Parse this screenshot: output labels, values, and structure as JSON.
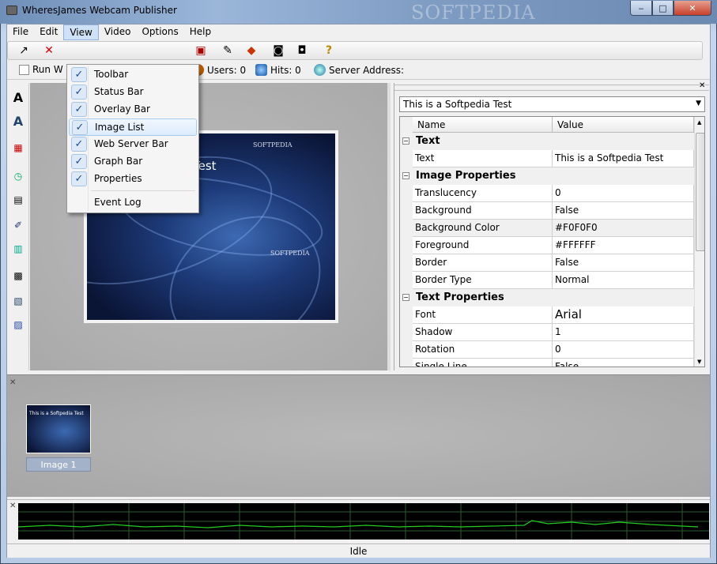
{
  "window": {
    "title": "WheresJames Webcam Publisher",
    "watermark": "SOFTPEDIA",
    "min": "‒",
    "max": "□",
    "close": "✕"
  },
  "menubar": [
    "File",
    "Edit",
    "View",
    "Video",
    "Options",
    "Help"
  ],
  "status_strip": {
    "run_label": "Run W",
    "users": "Users: 0",
    "hits": "Hits: 0",
    "server": "Server Address:"
  },
  "view_menu": {
    "items": [
      {
        "label": "Toolbar",
        "checked": true
      },
      {
        "label": "Status Bar",
        "checked": true
      },
      {
        "label": "Overlay Bar",
        "checked": true
      },
      {
        "label": "Image List",
        "checked": true
      },
      {
        "label": "Web Server Bar",
        "checked": true
      },
      {
        "label": "Graph Bar",
        "checked": true
      },
      {
        "label": "Properties",
        "checked": true
      }
    ],
    "event_log": "Event Log",
    "check_glyph": "✓"
  },
  "preview": {
    "overlay_text": "Test",
    "logo_top": "SOFTPEDIA",
    "logo_mid": "SOFTPEDIA"
  },
  "properties": {
    "combo_value": "This is a Softpedia Test",
    "col_name": "Name",
    "col_value": "Value",
    "categories": {
      "text": "Text",
      "image": "Image Properties",
      "textprops": "Text Properties"
    },
    "rows": {
      "text": [
        "Text",
        "This is a Softpedia Test"
      ],
      "translucency": [
        "Translucency",
        "0"
      ],
      "background": [
        "Background",
        "False"
      ],
      "background_color": [
        "Background Color",
        "#F0F0F0"
      ],
      "foreground": [
        "Foreground",
        "#FFFFFF"
      ],
      "border": [
        "Border",
        "False"
      ],
      "border_type": [
        "Border Type",
        "Normal"
      ],
      "font": [
        "Font",
        "Arial"
      ],
      "shadow": [
        "Shadow",
        "1"
      ],
      "rotation": [
        "Rotation",
        "0"
      ],
      "single_line": [
        "Single Line",
        "False"
      ]
    }
  },
  "image_list": {
    "thumb_label": "Image 1",
    "thumb_text": "This is a Softpedia Test"
  },
  "status": {
    "text": "Idle"
  },
  "colors": {
    "graph_line": "#22cc22",
    "graph_grid": "#2e5a2e",
    "menu_highlight": "#dcebfc"
  }
}
